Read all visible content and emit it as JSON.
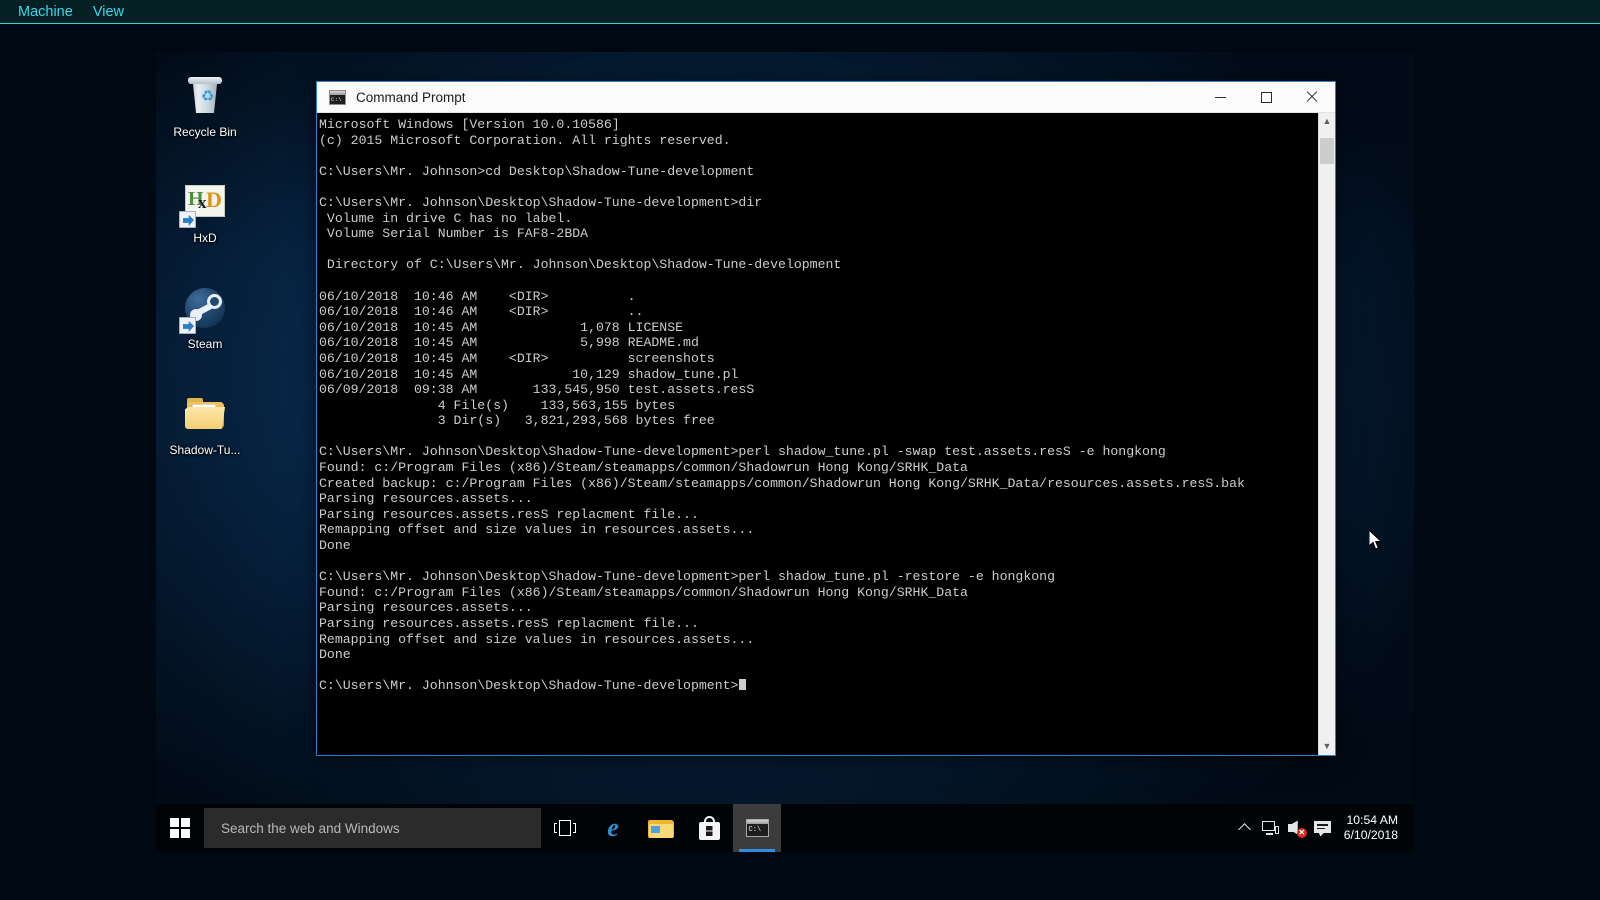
{
  "vbox": {
    "menu_items": [
      {
        "label": "Machine",
        "name": "machine"
      },
      {
        "label": "View",
        "name": "view"
      }
    ],
    "accent_color": "#36d9e8"
  },
  "desktop": {
    "icons": [
      {
        "label": "Recycle Bin",
        "icon": "recycle-bin-icon",
        "shortcut": false
      },
      {
        "label": "HxD",
        "icon": "hxd-icon",
        "shortcut": true
      },
      {
        "label": "Steam",
        "icon": "steam-icon",
        "shortcut": true
      },
      {
        "label": "Shadow-Tu...",
        "icon": "folder-icon",
        "shortcut": false
      }
    ]
  },
  "cmd_window": {
    "title": "Command Prompt",
    "icon": "command-prompt-icon",
    "icon_text": "C:\\",
    "minimize_label": "Minimize",
    "maximize_label": "Maximize",
    "close_label": "Close",
    "border_color": "#2e7fc4",
    "console_lines": [
      "Microsoft Windows [Version 10.0.10586]",
      "(c) 2015 Microsoft Corporation. All rights reserved.",
      "",
      "C:\\Users\\Mr. Johnson>cd Desktop\\Shadow-Tune-development",
      "",
      "C:\\Users\\Mr. Johnson\\Desktop\\Shadow-Tune-development>dir",
      " Volume in drive C has no label.",
      " Volume Serial Number is FAF8-2BDA",
      "",
      " Directory of C:\\Users\\Mr. Johnson\\Desktop\\Shadow-Tune-development",
      "",
      "06/10/2018  10:46 AM    <DIR>          .",
      "06/10/2018  10:46 AM    <DIR>          ..",
      "06/10/2018  10:45 AM             1,078 LICENSE",
      "06/10/2018  10:45 AM             5,998 README.md",
      "06/10/2018  10:45 AM    <DIR>          screenshots",
      "06/10/2018  10:45 AM            10,129 shadow_tune.pl",
      "06/09/2018  09:38 AM       133,545,950 test.assets.resS",
      "               4 File(s)    133,563,155 bytes",
      "               3 Dir(s)   3,821,293,568 bytes free",
      "",
      "C:\\Users\\Mr. Johnson\\Desktop\\Shadow-Tune-development>perl shadow_tune.pl -swap test.assets.resS -e hongkong",
      "Found: c:/Program Files (x86)/Steam/steamapps/common/Shadowrun Hong Kong/SRHK_Data",
      "Created backup: c:/Program Files (x86)/Steam/steamapps/common/Shadowrun Hong Kong/SRHK_Data/resources.assets.resS.bak",
      "Parsing resources.assets...",
      "Parsing resources.assets.resS replacment file...",
      "Remapping offset and size values in resources.assets...",
      "Done",
      "",
      "C:\\Users\\Mr. Johnson\\Desktop\\Shadow-Tune-development>perl shadow_tune.pl -restore -e hongkong",
      "Found: c:/Program Files (x86)/Steam/steamapps/common/Shadowrun Hong Kong/SRHK_Data",
      "Parsing resources.assets...",
      "Parsing resources.assets.resS replacment file...",
      "Remapping offset and size values in resources.assets...",
      "Done",
      ""
    ],
    "prompt_line": "C:\\Users\\Mr. Johnson\\Desktop\\Shadow-Tune-development>",
    "scrollbar": {
      "up_arrow": "▲",
      "down_arrow": "▼"
    }
  },
  "taskbar": {
    "start_label": "Start",
    "search_placeholder": "Search the web and Windows",
    "buttons": [
      {
        "name": "task-view-button",
        "label": "Task View",
        "active": false
      },
      {
        "name": "edge-button",
        "label": "Microsoft Edge",
        "active": false
      },
      {
        "name": "file-explorer-button",
        "label": "File Explorer",
        "active": false
      },
      {
        "name": "store-button",
        "label": "Store",
        "active": false
      },
      {
        "name": "command-prompt-taskbar-button",
        "label": "Command Prompt",
        "active": true
      }
    ],
    "tray": [
      {
        "name": "show-hidden-icons-button",
        "label": "Show hidden icons"
      },
      {
        "name": "network-icon",
        "label": "Network"
      },
      {
        "name": "volume-muted-icon",
        "label": "Volume muted"
      },
      {
        "name": "action-center-button",
        "label": "Action Center"
      }
    ],
    "clock": {
      "time": "10:54 AM",
      "date": "6/10/2018"
    }
  }
}
